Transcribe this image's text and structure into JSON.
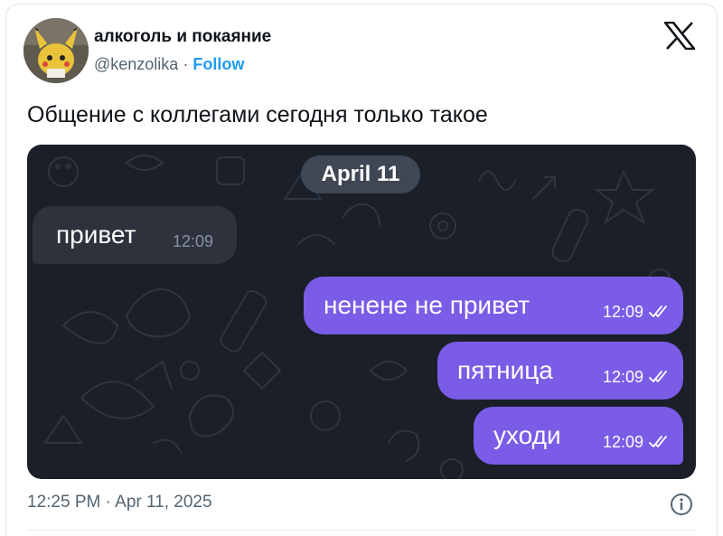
{
  "tweet": {
    "author_name": "алкоголь и покаяние",
    "author_handle": "@kenzolika",
    "separator": "·",
    "follow_label": "Follow",
    "text": "Общение с коллегами сегодня только такое",
    "timestamp": "12:25 PM · Apr 11, 2025"
  },
  "chat": {
    "date_label": "April 11",
    "messages": [
      {
        "direction": "incoming",
        "text": "привет",
        "time": "12:09"
      },
      {
        "direction": "outgoing",
        "text": "ненене не привет",
        "time": "12:09",
        "status": "read"
      },
      {
        "direction": "outgoing",
        "text": "пятница",
        "time": "12:09",
        "status": "read"
      },
      {
        "direction": "outgoing",
        "text": "уходи",
        "time": "12:09",
        "status": "read"
      }
    ]
  },
  "icons": {
    "logo": "x-logo-icon",
    "info": "info-icon",
    "read_receipt": "double-check-icon"
  },
  "colors": {
    "link": "#1d9bf0",
    "outgoing_bubble": "#7a5ce6",
    "incoming_bubble": "#2d323c",
    "chat_background": "#1a1f28"
  }
}
